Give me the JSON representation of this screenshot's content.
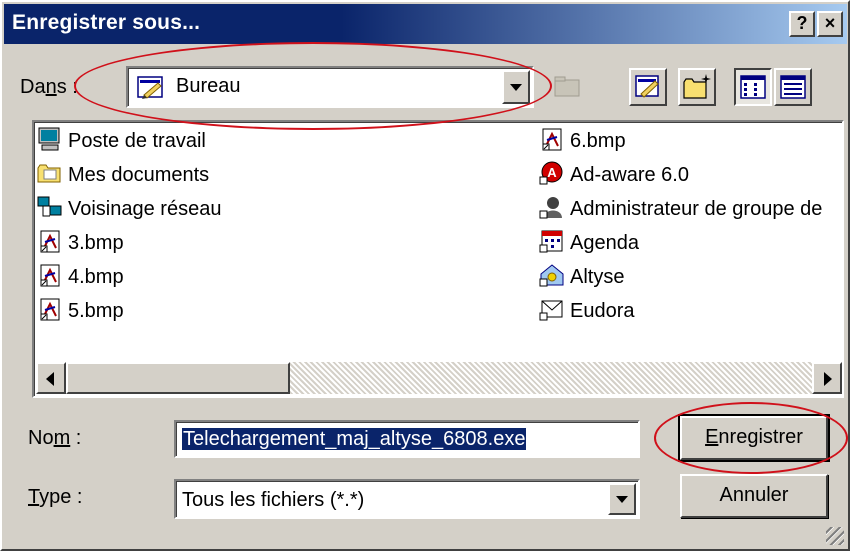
{
  "window": {
    "title": "Enregistrer sous...",
    "help_label": "?",
    "close_label": "×"
  },
  "location": {
    "label_before": "Da",
    "label_accel": "n",
    "label_after": "s :",
    "value": "Bureau"
  },
  "toolbar": {
    "icons": [
      "up-folder-icon",
      "desktop-icon",
      "new-folder-icon",
      "list-view-icon",
      "details-view-icon"
    ]
  },
  "files": {
    "left": [
      {
        "label": "Poste de travail",
        "icon": "computer-icon"
      },
      {
        "label": "Mes documents",
        "icon": "documents-folder-icon"
      },
      {
        "label": "Voisinage réseau",
        "icon": "network-icon"
      },
      {
        "label": "3.bmp",
        "icon": "bitmap-file-icon"
      },
      {
        "label": "4.bmp",
        "icon": "bitmap-file-icon"
      },
      {
        "label": "5.bmp",
        "icon": "bitmap-file-icon"
      }
    ],
    "right": [
      {
        "label": "6.bmp",
        "icon": "bitmap-file-icon"
      },
      {
        "label": "Ad-aware 6.0",
        "icon": "adaware-shortcut-icon"
      },
      {
        "label": "Administrateur de groupe de",
        "icon": "admin-shortcut-icon"
      },
      {
        "label": "Agenda",
        "icon": "agenda-shortcut-icon"
      },
      {
        "label": "Altyse",
        "icon": "altyse-shortcut-icon"
      },
      {
        "label": "Eudora",
        "icon": "eudora-shortcut-icon"
      }
    ]
  },
  "filename": {
    "label_before": "No",
    "label_accel": "m",
    "label_after": " :",
    "value": "Telechargement_maj_altyse_6808.exe"
  },
  "filetype": {
    "label_accel": "T",
    "label_after": "ype :",
    "value": "Tous les fichiers (*.*)"
  },
  "buttons": {
    "save_accel": "E",
    "save_rest": "nregistrer",
    "cancel_label": "Annuler"
  },
  "colors": {
    "annotation": "#d0101a",
    "title_bar": "#0a246a",
    "dialog_face": "#d4d0c8"
  }
}
